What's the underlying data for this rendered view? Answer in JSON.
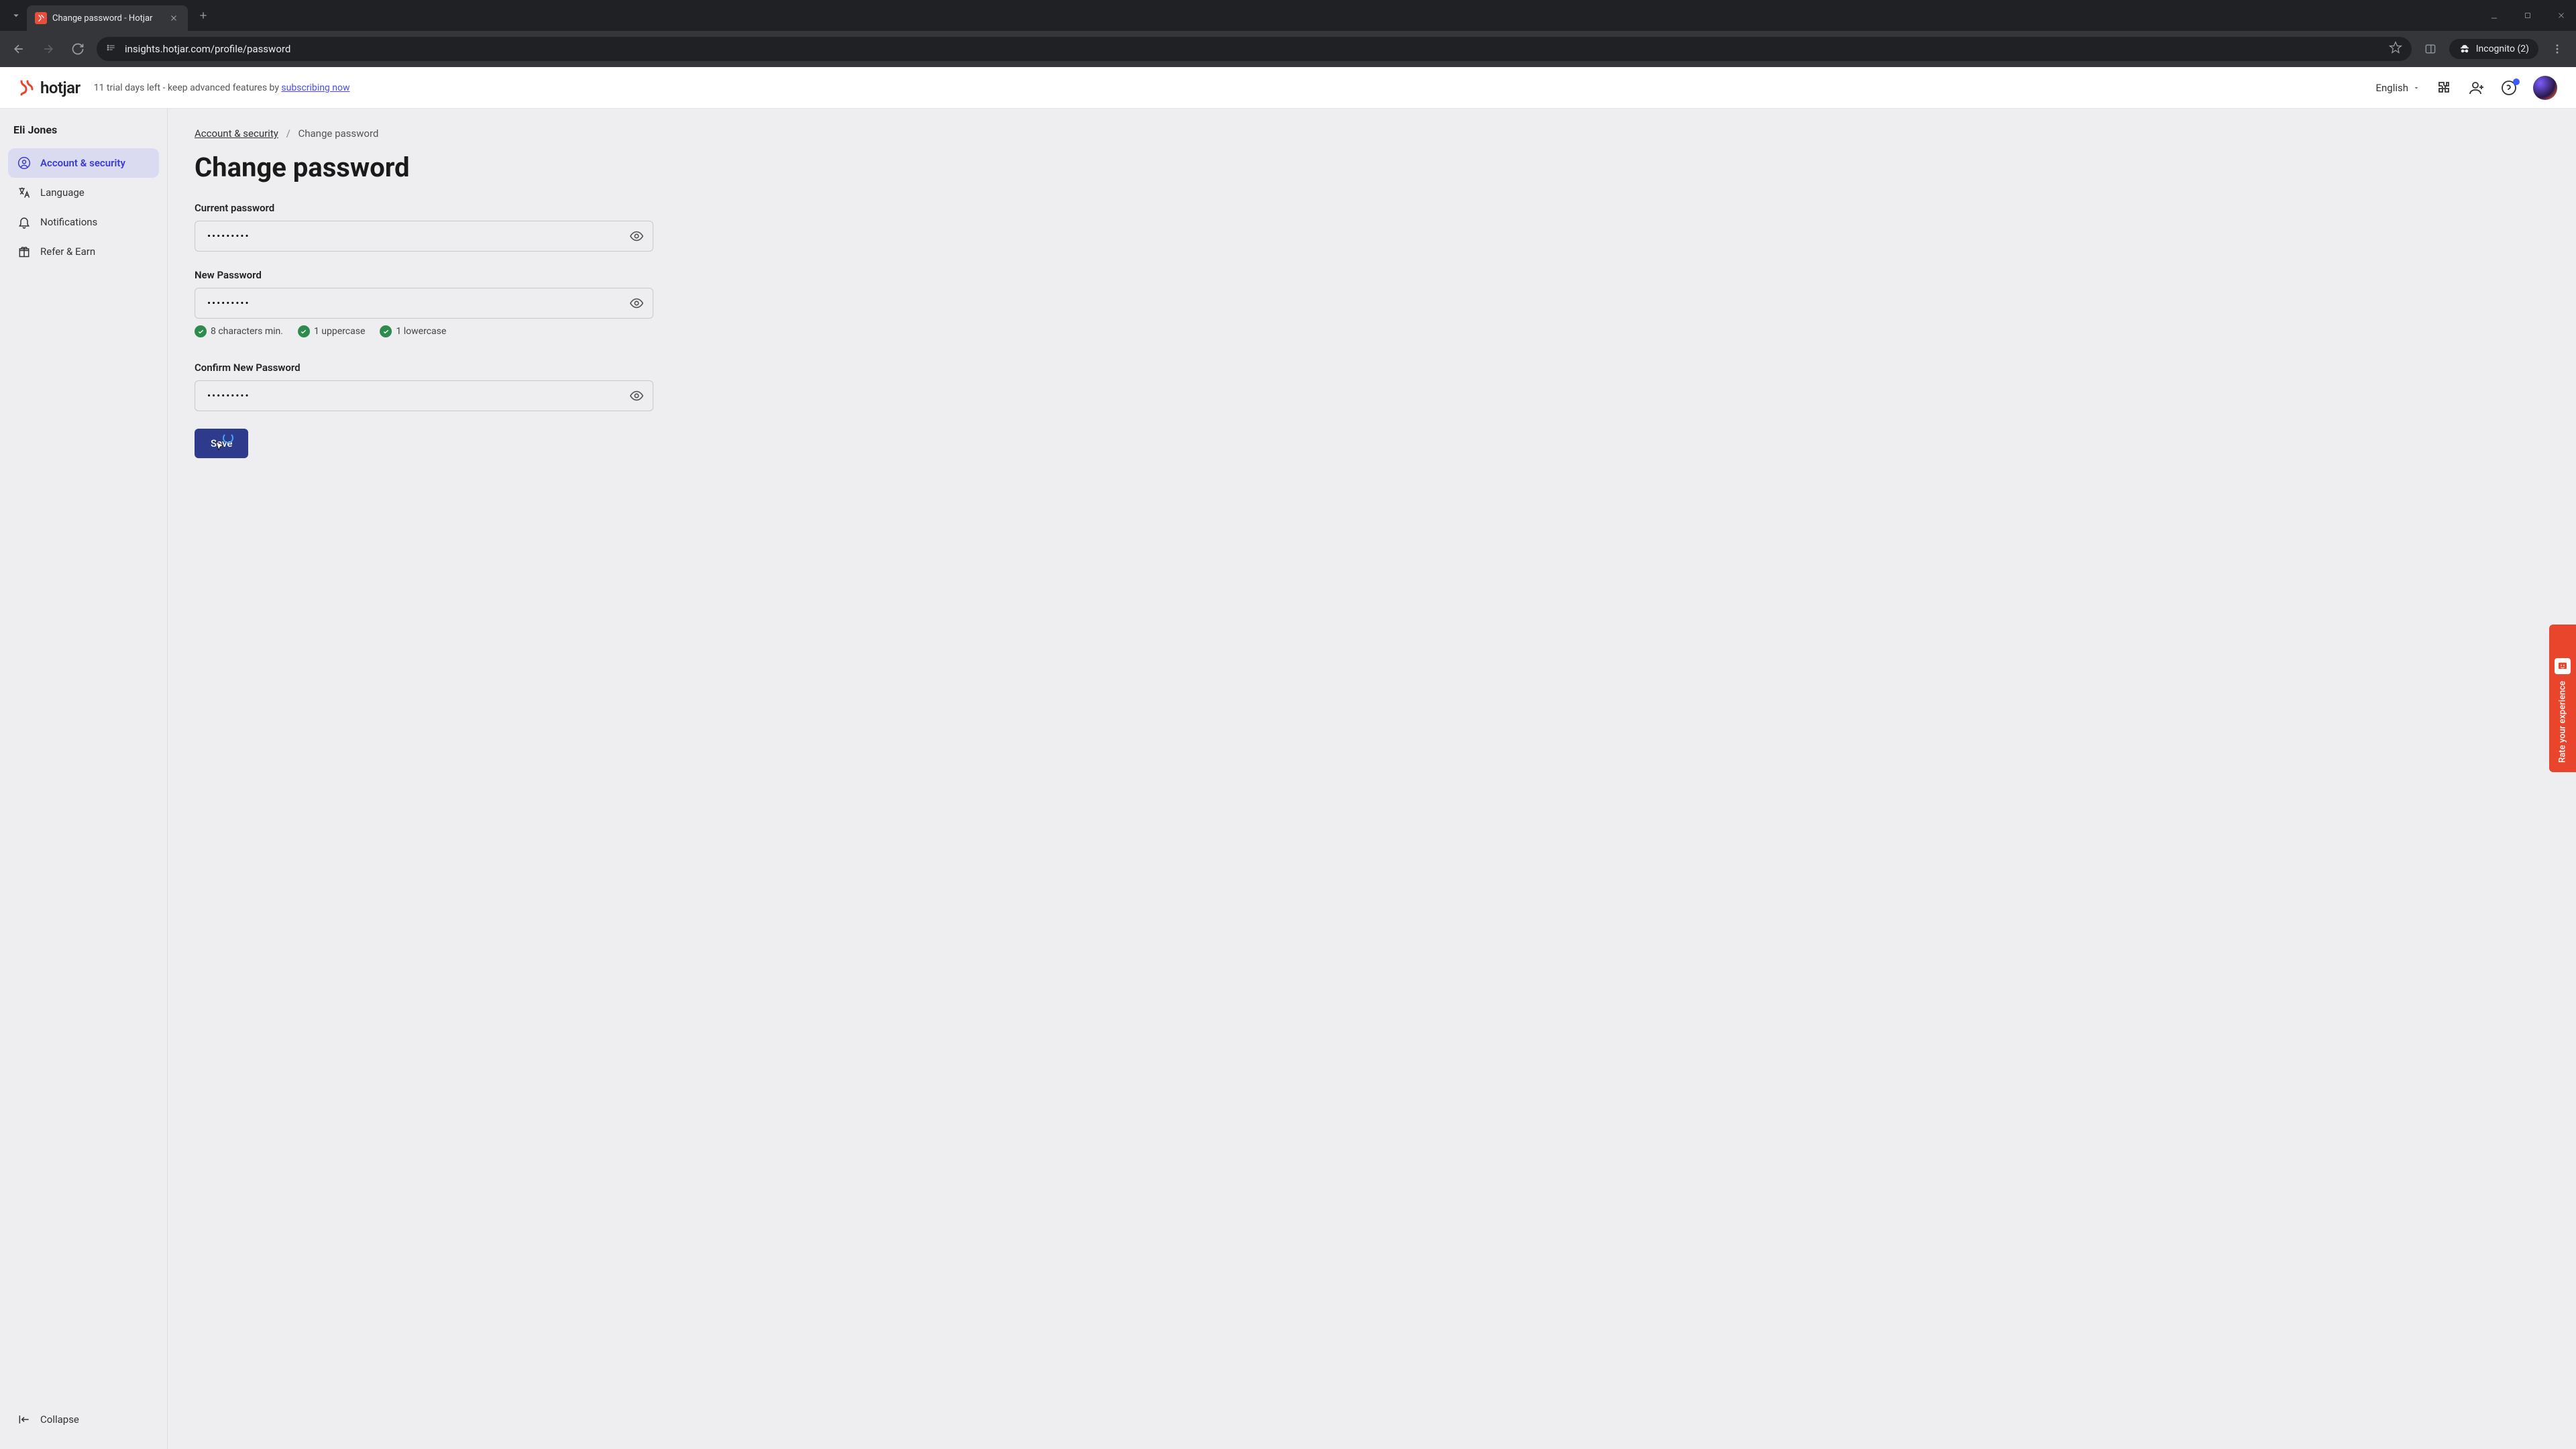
{
  "browser": {
    "tab_title": "Change password - Hotjar",
    "url": "insights.hotjar.com/profile/password",
    "incognito_label": "Incognito (2)"
  },
  "header": {
    "logo_text": "hotjar",
    "trial_prefix": "11 trial days left - keep advanced features by ",
    "trial_link": "subscribing now",
    "language": "English"
  },
  "sidebar": {
    "user_name": "Eli Jones",
    "items": [
      {
        "label": "Account & security",
        "icon": "user-circle-icon",
        "active": true
      },
      {
        "label": "Language",
        "icon": "language-icon",
        "active": false
      },
      {
        "label": "Notifications",
        "icon": "bell-icon",
        "active": false
      },
      {
        "label": "Refer & Earn",
        "icon": "gift-icon",
        "active": false
      }
    ],
    "collapse_label": "Collapse"
  },
  "breadcrumb": {
    "parent": "Account & security",
    "current": "Change password"
  },
  "page": {
    "title": "Change password",
    "current_pw_label": "Current password",
    "current_pw_value": "•••••••••",
    "new_pw_label": "New Password",
    "new_pw_value": "•••••••••",
    "confirm_pw_label": "Confirm New Password",
    "confirm_pw_value": "•••••••••",
    "rules": [
      "8 characters min.",
      "1 uppercase",
      "1 lowercase"
    ],
    "save_label": "Save"
  },
  "feedback": {
    "label": "Rate your experience"
  }
}
